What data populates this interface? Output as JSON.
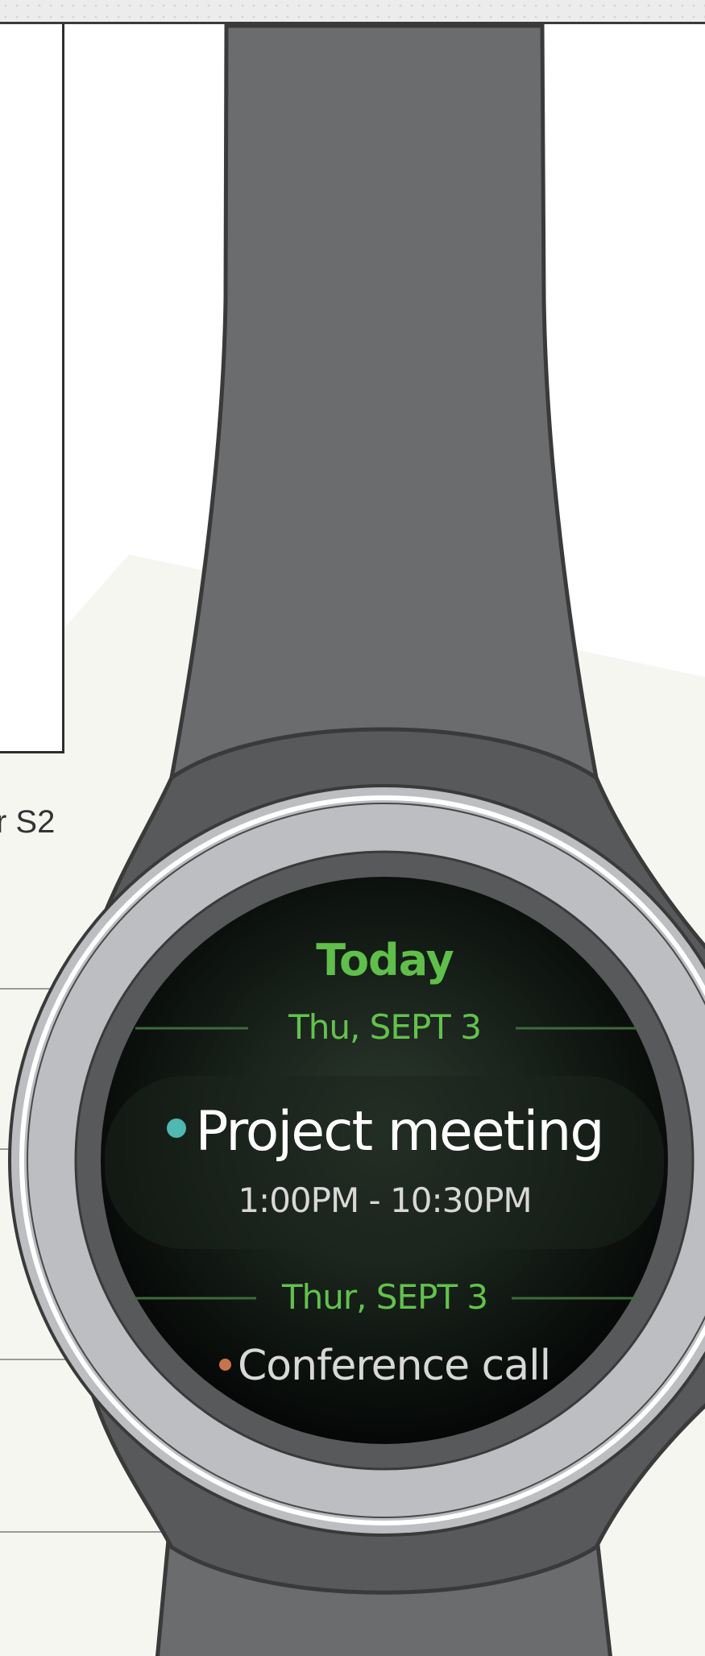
{
  "caption": {
    "text": "r S2"
  },
  "watch": {
    "header": "Today",
    "sections": [
      {
        "date": "Thu, SEPT 3",
        "event": "Project meeting",
        "time": "1:00PM - 10:30PM",
        "dot_color": "#4fb8b0"
      },
      {
        "date": "Thur, SEPT 3",
        "event": "Conference call",
        "dot_color": "#c8734e"
      }
    ]
  },
  "colors": {
    "accent_green": "#5fbf4a",
    "strap": "#6b6c6e",
    "bezel": "#bdbec1",
    "screen": "#0b0f0c"
  }
}
